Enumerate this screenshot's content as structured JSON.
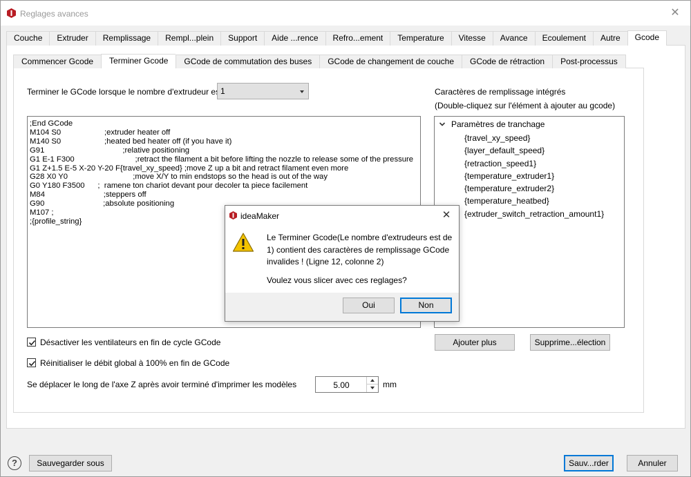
{
  "window": {
    "title": "Reglages avances",
    "close_glyph": "✕"
  },
  "main_tabs": [
    {
      "label": "Couche"
    },
    {
      "label": "Extruder"
    },
    {
      "label": "Remplissage"
    },
    {
      "label": "Rempl...plein"
    },
    {
      "label": "Support"
    },
    {
      "label": "Aide ...rence"
    },
    {
      "label": "Refro...ement"
    },
    {
      "label": "Temperature"
    },
    {
      "label": "Vitesse"
    },
    {
      "label": "Avance"
    },
    {
      "label": "Ecoulement"
    },
    {
      "label": "Autre"
    },
    {
      "label": "Gcode"
    }
  ],
  "sub_tabs": [
    {
      "label": "Commencer Gcode"
    },
    {
      "label": "Terminer Gcode"
    },
    {
      "label": "GCode de commutation des buses"
    },
    {
      "label": "GCode de changement de couche"
    },
    {
      "label": "GCode de rétraction"
    },
    {
      "label": "Post-processus"
    }
  ],
  "extruder_count": {
    "label": "Terminer le GCode lorsque le nombre d'extrudeur est",
    "value": "1"
  },
  "gcode_lines": [
    ";End GCode",
    "M104 S0                    ;extruder heater off",
    "M140 S0                    ;heated bed heater off (if you have it)",
    "G91                                    ;relative positioning",
    "G1 E-1 F300                            ;retract the filament a bit before lifting the nozzle to release some of the pressure",
    "G1 Z+1.5 E-5 X-20 Y-20 F{travel_xy_speed} ;move Z up a bit and retract filament even more",
    "G28 X0 Y0                              ;move X/Y to min endstops so the head is out of the way",
    "G0 Y180 F3500      ;  ramene ton chariot devant pour decoler ta piece facilement",
    "M84                           ;steppers off",
    "G90                           ;absolute positioning",
    "M107 ;",
    ";{profile_string}"
  ],
  "placeholders": {
    "title": "Caractères de remplissage intégrés",
    "hint": "(Double-cliquez sur l'élément à ajouter au gcode)",
    "group": "Paramètres de tranchage",
    "items": [
      "{travel_xy_speed}",
      "{layer_default_speed}",
      "{retraction_speed1}",
      "{temperature_extruder1}",
      "{temperature_extruder2}",
      "{temperature_heatbed}",
      "{extruder_switch_retraction_amount1}"
    ],
    "add_button": "Ajouter plus",
    "delete_button": "Supprime...élection"
  },
  "options": {
    "fans_off": {
      "label": "Désactiver les ventilateurs en fin de cycle GCode",
      "checked": true
    },
    "reset_flow": {
      "label": "Réinitialiser le débit global à 100% en fin de GCode",
      "checked": true
    },
    "z_move": {
      "label": "Se déplacer le long de l'axe Z après avoir terminé d'imprimer les modèles",
      "value": "5.00",
      "unit": "mm"
    }
  },
  "footer": {
    "help_glyph": "?",
    "save_as": "Sauvegarder sous",
    "save": "Sauv...rder",
    "cancel": "Annuler"
  },
  "dialog": {
    "title": "ideaMaker",
    "message": "Le Terminer Gcode(Le nombre d'extrudeurs est de 1) contient des caractères de remplissage GCode invalides ! (Ligne 12, colonne 2)",
    "question": "Voulez vous slicer avec ces reglages?",
    "yes": "Oui",
    "no": "Non",
    "close_glyph": "✕"
  },
  "colors": {
    "brand_red": "#b81d24",
    "accent_blue": "#0078d7",
    "warning_yellow": "#f3c300"
  }
}
